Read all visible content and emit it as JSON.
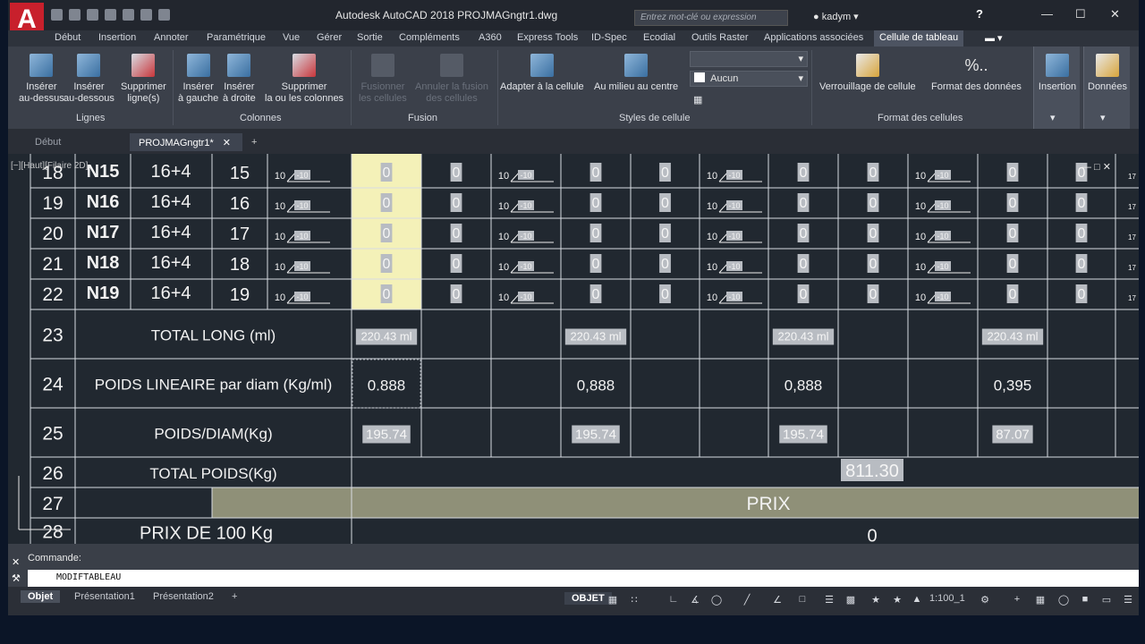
{
  "titlebar": {
    "title": "Autodesk AutoCAD 2018     PROJMAGngtr1.dwg",
    "search_placeholder": "Entrez mot-clé ou expression",
    "user": "kadym",
    "help": "?"
  },
  "menu": [
    "Début",
    "Insertion",
    "Annoter",
    "Paramétrique",
    "Vue",
    "Gérer",
    "Sortie",
    "Compléments",
    "A360",
    "Express Tools",
    "ID-Spec",
    "Ecodial",
    "Outils Raster",
    "Applications associées",
    "Cellule de tableau"
  ],
  "ribbon": {
    "lignes": {
      "label": "Lignes",
      "buttons": [
        "Insérer\nau-dessus",
        "Insérer\nau-dessous",
        "Supprimer\nligne(s)"
      ]
    },
    "colonnes": {
      "label": "Colonnes",
      "buttons": [
        "Insérer\nà gauche",
        "Insérer\nà droite",
        "Supprimer\nla ou les colonnes"
      ]
    },
    "fusion": {
      "label": "Fusion",
      "buttons": [
        "Fusionner\nles cellules",
        "Annuler la fusion\ndes cellules"
      ]
    },
    "styles": {
      "label": "Styles de cellule",
      "buttons": [
        "Adapter à la cellule",
        "Au milieu au centre"
      ],
      "combo_top": "",
      "combo_bottom": "Aucun"
    },
    "format": {
      "label": "Format des cellules",
      "buttons": [
        "Verrouillage de cellule",
        "Format des données"
      ],
      "fmt_symbol": "%.."
    },
    "side": [
      "Insertion",
      "Données"
    ]
  },
  "doctabs": [
    "Début",
    "PROJMAGngtr1*"
  ],
  "viewport_label": "[−][Haut][Filaire 2D]",
  "table": {
    "rows": [
      {
        "num": "18",
        "name": "N15",
        "spec": "16+4",
        "n": "15"
      },
      {
        "num": "19",
        "name": "N16",
        "spec": "16+4",
        "n": "16"
      },
      {
        "num": "20",
        "name": "N17",
        "spec": "16+4",
        "n": "17"
      },
      {
        "num": "21",
        "name": "N18",
        "spec": "16+4",
        "n": "18"
      },
      {
        "num": "22",
        "name": "N19",
        "spec": "16+4",
        "n": "19"
      }
    ],
    "zero": "0",
    "sketch_text": "10",
    "sketch_box": "-10",
    "totals": [
      {
        "num": "23",
        "label": "TOTAL LONG (ml)",
        "values": [
          "220.43 ml",
          "220.43 ml",
          "220.43 ml",
          "220.43 ml"
        ]
      },
      {
        "num": "24",
        "label": "POIDS LINEAIRE par diam (Kg/ml)",
        "values": [
          "0.888",
          "0,888",
          "0,888",
          "0,395"
        ]
      },
      {
        "num": "25",
        "label": "POIDS/DIAM(Kg)",
        "values": [
          "195.74",
          "195.74",
          "195.74",
          "87.07"
        ]
      },
      {
        "num": "26",
        "label": "TOTAL POIDS(Kg)",
        "values": [
          "811.30"
        ]
      },
      {
        "num": "27",
        "label": "",
        "values": [
          "PRIX"
        ]
      },
      {
        "num": "28",
        "label": "PRIX DE 100 Kg",
        "values": [
          "0"
        ]
      }
    ]
  },
  "command": {
    "label": "Commande:",
    "value": "MODIFTABLEAU"
  },
  "layouts": [
    "Objet",
    "Présentation1",
    "Présentation2"
  ],
  "status": {
    "model": "OBJET",
    "scale": "1:100_1"
  }
}
